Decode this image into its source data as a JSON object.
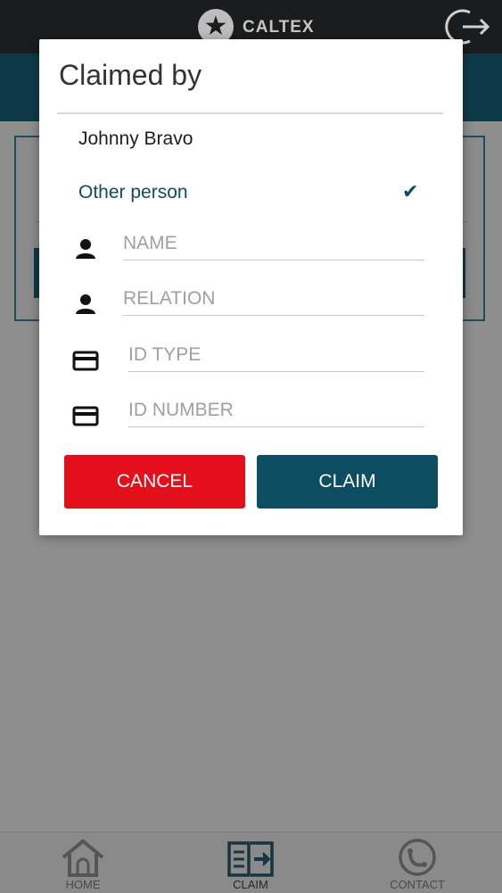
{
  "header": {
    "brand": "CALTEX",
    "logout_icon": "logout-icon"
  },
  "dialog": {
    "title": "Claimed by",
    "options": [
      {
        "label": "Johnny Bravo",
        "selected": false
      },
      {
        "label": "Other person",
        "selected": true
      }
    ],
    "check_icon": "checkmark-icon",
    "fields": {
      "name": {
        "placeholder": "NAME",
        "value": "",
        "icon": "person-icon"
      },
      "relation": {
        "placeholder": "RELATION",
        "value": "",
        "icon": "person-icon"
      },
      "id_type": {
        "placeholder": "ID TYPE",
        "value": "",
        "icon": "id-card-icon"
      },
      "id_number": {
        "placeholder": "ID NUMBER",
        "value": "",
        "icon": "id-card-icon"
      }
    },
    "buttons": {
      "cancel": "CANCEL",
      "claim": "CLAIM"
    }
  },
  "bottom_nav": {
    "items": [
      {
        "label": "HOME",
        "icon": "home-icon"
      },
      {
        "label": "CLAIM",
        "icon": "claim-book-icon",
        "active": true
      },
      {
        "label": "CONTACT",
        "icon": "contact-icon"
      }
    ]
  },
  "colors": {
    "accent": "#0d4d61",
    "cancel": "#e3101c",
    "topbar": "#1b1c1d",
    "overlay_bg": "#8e8e8e"
  }
}
